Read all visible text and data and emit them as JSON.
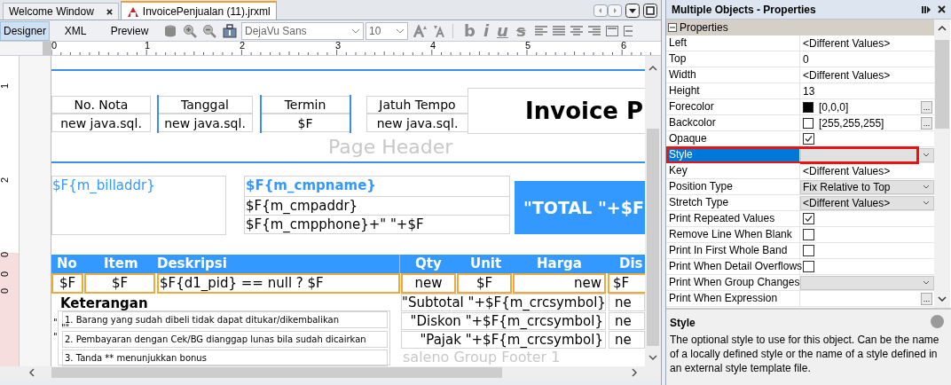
{
  "editor_tabs": [
    {
      "label": "Welcome Window",
      "selected": false,
      "kind": "plain"
    },
    {
      "label": "InvoicePenjualan (11).jrxml",
      "selected": true,
      "kind": "report"
    }
  ],
  "toolbar": {
    "modes": [
      {
        "label": "Designer",
        "selected": true
      },
      {
        "label": "XML",
        "selected": false
      },
      {
        "label": "Preview",
        "selected": false
      }
    ],
    "font": "DejaVu Sans",
    "size": "10",
    "format_glyphs": [
      "b",
      "i",
      "u",
      "s"
    ]
  },
  "ruler": {
    "horizontal": [
      "0",
      "1",
      "2",
      "3",
      "4",
      "5",
      "6"
    ],
    "vertical": [
      "1",
      "2",
      "0",
      "0",
      "0"
    ]
  },
  "report": {
    "header_fields": [
      {
        "label": "No. Nota",
        "value": "new java.sql."
      },
      {
        "label": "Tanggal",
        "value": "new java.sql."
      },
      {
        "label": "Termin",
        "value": "$F"
      },
      {
        "label": "Jatuh Tempo",
        "value": "new java.sql."
      }
    ],
    "page_header_band": "Page Header",
    "title": "Invoice P",
    "bill_address": "$F{m_billaddr}",
    "company_lines": [
      "$F{m_cmpname}",
      "$F{m_cmpaddr}",
      "$F{m_cmpphone}+\" \"+$F"
    ],
    "total": "\"TOTAL \"+$F",
    "detail_columns": [
      "No",
      "Item",
      "Deskripsi",
      "Qty",
      "Unit",
      "Harga",
      "Dis"
    ],
    "detail_cells": [
      "$F",
      "$F",
      "$F{d1_pid} == null ? $F",
      "new",
      "$F",
      "new",
      "$F"
    ],
    "notes_title": "Keterangan",
    "notes": [
      "1. Barang yang sudah dibeli tidak dapat ditukar/dikembalikan",
      "2. Pembayaran dengan Cek/BG dianggap lunas bila sudah dicairkan",
      "3. Tanda ** menunjukkan bonus"
    ],
    "quote_marks": [
      "\"",
      "\"\"",
      "\""
    ],
    "summary_labels": [
      "\"Subtotal \"+$F{m_crcsymbol}",
      "\"Diskon \"+$F{m_crcsymbol}",
      "\"Pajak \"+$F{m_crcsymbol}"
    ],
    "summary_values": [
      "ne",
      "ne",
      "ne"
    ],
    "group_footer_band": "saleno Group Footer 1"
  },
  "properties": {
    "title": "Multiple Objects - Properties",
    "section": "Properties",
    "rows": [
      {
        "label": "Left",
        "kind": "text",
        "value": "<Different Values>",
        "selected": false
      },
      {
        "label": "Top",
        "kind": "text",
        "value": "0",
        "selected": false
      },
      {
        "label": "Width",
        "kind": "text",
        "value": "<Different Values>",
        "selected": false
      },
      {
        "label": "Height",
        "kind": "text",
        "value": "13",
        "selected": false
      },
      {
        "label": "Forecolor",
        "kind": "color",
        "value": "[0,0,0]",
        "color": "#000000",
        "button": "...",
        "selected": false
      },
      {
        "label": "Backcolor",
        "kind": "color",
        "value": "[255,255,255]",
        "color": "#ffffff",
        "button": "...",
        "selected": false
      },
      {
        "label": "Opaque",
        "kind": "check",
        "checked": true,
        "selected": false
      },
      {
        "label": "Style",
        "kind": "combo",
        "selected": true
      },
      {
        "label": "Key",
        "kind": "text",
        "value": "<Different Values>",
        "selected": false
      },
      {
        "label": "Position Type",
        "kind": "combo",
        "value": "Fix Relative to Top",
        "selected": false
      },
      {
        "label": "Stretch Type",
        "kind": "combo",
        "value": "<Different Values>",
        "selected": false
      },
      {
        "label": "Print Repeated Values",
        "kind": "check",
        "checked": true,
        "selected": false
      },
      {
        "label": "Remove Line When Blank",
        "kind": "check",
        "checked": false,
        "selected": false
      },
      {
        "label": "Print In First Whole Band",
        "kind": "check",
        "checked": false,
        "selected": false
      },
      {
        "label": "Print When Detail Overflows",
        "kind": "check",
        "checked": false,
        "selected": false
      },
      {
        "label": "Print When Group Changes",
        "kind": "combo",
        "selected": false
      },
      {
        "label": "Print When Expression",
        "kind": "text",
        "button": "...",
        "selected": false
      }
    ],
    "description": {
      "title": "Style",
      "text": "The optional style to use for this object. Can be the name of a locally defined style or the name of a style defined in an external style template file."
    }
  }
}
